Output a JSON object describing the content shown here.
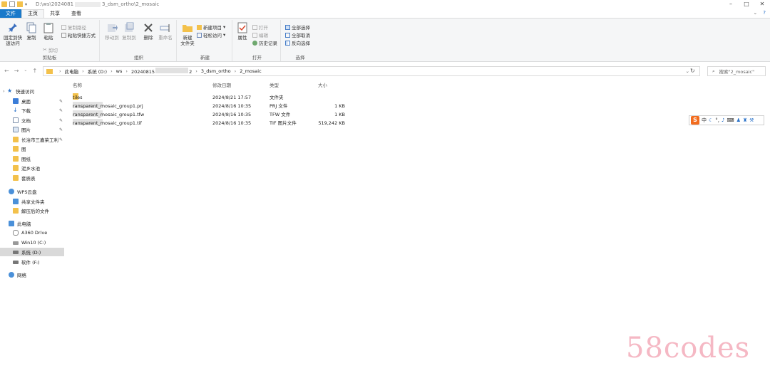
{
  "window": {
    "title": "D:\\ws\\2024081",
    "title_suffix": "3_dsm_ortho\\2_mosaic"
  },
  "ribbon_tabs": [
    {
      "label": "文件"
    },
    {
      "label": "主页"
    },
    {
      "label": "共享"
    },
    {
      "label": "查看"
    }
  ],
  "ribbon": {
    "clipboard": {
      "pin_quick": "固定到快\n速访问",
      "copy": "复制",
      "paste": "粘贴",
      "copy_path": "复制路径",
      "paste_shortcut": "粘贴快捷方式",
      "cut": "剪切",
      "label": "剪贴板"
    },
    "organize": {
      "move_to": "移动到",
      "copy_to": "复制到",
      "delete": "删除",
      "rename": "重命名",
      "label": "组织"
    },
    "new": {
      "new_folder": "新建\n文件夹",
      "new_item": "新建项目",
      "easy_access": "轻松访问",
      "label": "新建"
    },
    "open": {
      "properties": "属性",
      "open": "打开",
      "edit": "编辑",
      "history": "历史记录",
      "label": "打开"
    },
    "select": {
      "select_all": "全部选择",
      "select_none": "全部取消",
      "invert": "反向选择",
      "label": "选择"
    }
  },
  "address": {
    "crumbs": [
      "此电脑",
      "系统 (D:)",
      "ws",
      "20240815",
      "2",
      "3_dsm_ortho",
      "2_mosaic"
    ],
    "search_placeholder": "搜索\"2_mosaic\""
  },
  "nav_pane": {
    "quick_access": "快速访问",
    "quick_items": [
      "桌面",
      "下载",
      "文档",
      "图片",
      "长治市三嘉荣工利",
      "图",
      "图纸",
      "泥乡水池",
      "套质表"
    ],
    "wps": "WPS云盘",
    "wps_items": [
      "共享文件夹",
      "解压后的文件"
    ],
    "this_pc": "此电脑",
    "pc_items": [
      "A360 Drive",
      "Win10 (C:)",
      "系统 (D:)",
      "软件 (F:)"
    ],
    "network": "网络"
  },
  "file_list": {
    "columns": [
      "名称",
      "修改日期",
      "类型",
      "大小"
    ],
    "rows": [
      {
        "name_prefix": "tiles",
        "name_suffix": "",
        "date": "2024/8/21 17:57",
        "type": "文件夹",
        "size": "",
        "icon": "folder-icon"
      },
      {
        "name_prefix": "20240815",
        "name_suffix": "ransparent_mosaic_group1.prj",
        "date": "2024/8/16 10:35",
        "type": "PRJ 文件",
        "size": "1 KB",
        "icon": "file-icon"
      },
      {
        "name_prefix": "20240815",
        "name_suffix": "ransparent_mosaic_group1.tfw",
        "date": "2024/8/16 10:35",
        "type": "TFW 文件",
        "size": "1 KB",
        "icon": "file-icon"
      },
      {
        "name_prefix": "20240815",
        "name_suffix": "ransparent_mosaic_group1.tif",
        "date": "2024/8/16 10:35",
        "type": "TIF 图片文件",
        "size": "519,242 KB",
        "icon": "image-file-icon"
      }
    ]
  },
  "ime": {
    "logo": "S",
    "mode": "中"
  },
  "watermark": "58codes"
}
